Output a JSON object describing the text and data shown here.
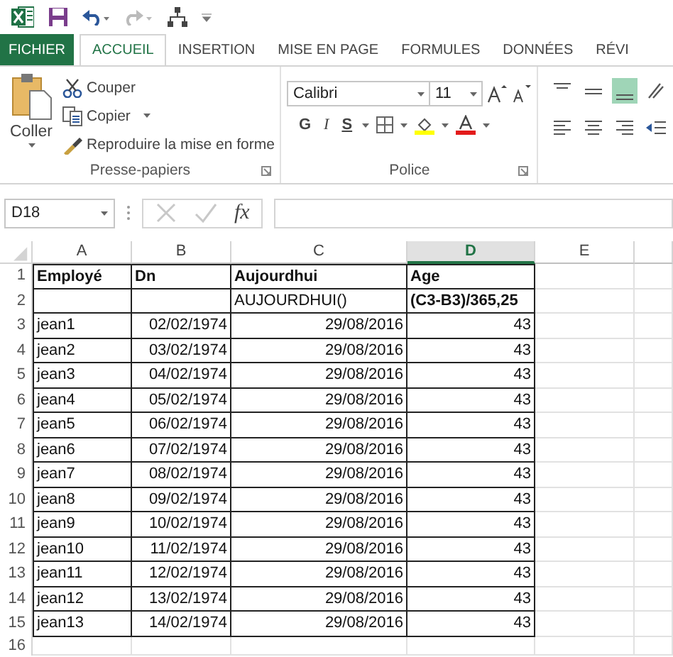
{
  "tabs": [
    {
      "label": "FICHIER",
      "kind": "file",
      "selected": false
    },
    {
      "label": "ACCUEIL",
      "kind": "tab",
      "selected": true
    },
    {
      "label": "INSERTION",
      "kind": "tab",
      "selected": false
    },
    {
      "label": "MISE EN PAGE",
      "kind": "tab",
      "selected": false
    },
    {
      "label": "FORMULES",
      "kind": "tab",
      "selected": false
    },
    {
      "label": "DONNÉES",
      "kind": "tab",
      "selected": false
    },
    {
      "label": "RÉVI",
      "kind": "tab",
      "selected": false
    }
  ],
  "clipboard": {
    "paste": "Coller",
    "cut": "Couper",
    "copy": "Copier",
    "format_painter": "Reproduire la mise en forme",
    "label": "Presse-papiers"
  },
  "font": {
    "font_name": "Calibri",
    "font_size": "11",
    "bold": "G",
    "italic": "I",
    "underline": "S",
    "label": "Police"
  },
  "formula_bar": {
    "name_box": "D18",
    "fx": "fx"
  },
  "columns": [
    {
      "label": "A",
      "selected": false
    },
    {
      "label": "B",
      "selected": false
    },
    {
      "label": "C",
      "selected": false
    },
    {
      "label": "D",
      "selected": true
    },
    {
      "label": "E",
      "selected": false
    }
  ],
  "rows": [
    {
      "number": "1",
      "cells": [
        {
          "text": "Employé",
          "kind": "text",
          "bold": true
        },
        {
          "text": "Dn",
          "kind": "text",
          "bold": true
        },
        {
          "text": "Aujourdhui",
          "kind": "text",
          "bold": true
        },
        {
          "text": "Age",
          "kind": "text",
          "bold": true
        }
      ]
    },
    {
      "number": "2",
      "cells": [
        null,
        null,
        {
          "text": "AUJOURDHUI()",
          "kind": "text",
          "bold": false
        },
        {
          "text": "(C3-B3)/365,25",
          "kind": "text",
          "bold": true
        }
      ]
    },
    {
      "number": "3",
      "cells": [
        {
          "text": "jean1",
          "kind": "text",
          "bold": false
        },
        {
          "text": "02/02/1974",
          "kind": "number",
          "bold": false
        },
        {
          "text": "29/08/2016",
          "kind": "number",
          "bold": false
        },
        {
          "text": "43",
          "kind": "number",
          "bold": false
        }
      ]
    },
    {
      "number": "4",
      "cells": [
        {
          "text": "jean2",
          "kind": "text",
          "bold": false
        },
        {
          "text": "03/02/1974",
          "kind": "number",
          "bold": false
        },
        {
          "text": "29/08/2016",
          "kind": "number",
          "bold": false
        },
        {
          "text": "43",
          "kind": "number",
          "bold": false
        }
      ]
    },
    {
      "number": "5",
      "cells": [
        {
          "text": "jean3",
          "kind": "text",
          "bold": false
        },
        {
          "text": "04/02/1974",
          "kind": "number",
          "bold": false
        },
        {
          "text": "29/08/2016",
          "kind": "number",
          "bold": false
        },
        {
          "text": "43",
          "kind": "number",
          "bold": false
        }
      ]
    },
    {
      "number": "6",
      "cells": [
        {
          "text": "jean4",
          "kind": "text",
          "bold": false
        },
        {
          "text": "05/02/1974",
          "kind": "number",
          "bold": false
        },
        {
          "text": "29/08/2016",
          "kind": "number",
          "bold": false
        },
        {
          "text": "43",
          "kind": "number",
          "bold": false
        }
      ]
    },
    {
      "number": "7",
      "cells": [
        {
          "text": "jean5",
          "kind": "text",
          "bold": false
        },
        {
          "text": "06/02/1974",
          "kind": "number",
          "bold": false
        },
        {
          "text": "29/08/2016",
          "kind": "number",
          "bold": false
        },
        {
          "text": "43",
          "kind": "number",
          "bold": false
        }
      ]
    },
    {
      "number": "8",
      "cells": [
        {
          "text": "jean6",
          "kind": "text",
          "bold": false
        },
        {
          "text": "07/02/1974",
          "kind": "number",
          "bold": false
        },
        {
          "text": "29/08/2016",
          "kind": "number",
          "bold": false
        },
        {
          "text": "43",
          "kind": "number",
          "bold": false
        }
      ]
    },
    {
      "number": "9",
      "cells": [
        {
          "text": "jean7",
          "kind": "text",
          "bold": false
        },
        {
          "text": "08/02/1974",
          "kind": "number",
          "bold": false
        },
        {
          "text": "29/08/2016",
          "kind": "number",
          "bold": false
        },
        {
          "text": "43",
          "kind": "number",
          "bold": false
        }
      ]
    },
    {
      "number": "10",
      "cells": [
        {
          "text": "jean8",
          "kind": "text",
          "bold": false
        },
        {
          "text": "09/02/1974",
          "kind": "number",
          "bold": false
        },
        {
          "text": "29/08/2016",
          "kind": "number",
          "bold": false
        },
        {
          "text": "43",
          "kind": "number",
          "bold": false
        }
      ]
    },
    {
      "number": "11",
      "cells": [
        {
          "text": "jean9",
          "kind": "text",
          "bold": false
        },
        {
          "text": "10/02/1974",
          "kind": "number",
          "bold": false
        },
        {
          "text": "29/08/2016",
          "kind": "number",
          "bold": false
        },
        {
          "text": "43",
          "kind": "number",
          "bold": false
        }
      ]
    },
    {
      "number": "12",
      "cells": [
        {
          "text": "jean10",
          "kind": "text",
          "bold": false
        },
        {
          "text": "11/02/1974",
          "kind": "number",
          "bold": false
        },
        {
          "text": "29/08/2016",
          "kind": "number",
          "bold": false
        },
        {
          "text": "43",
          "kind": "number",
          "bold": false
        }
      ]
    },
    {
      "number": "13",
      "cells": [
        {
          "text": "jean11",
          "kind": "text",
          "bold": false
        },
        {
          "text": "12/02/1974",
          "kind": "number",
          "bold": false
        },
        {
          "text": "29/08/2016",
          "kind": "number",
          "bold": false
        },
        {
          "text": "43",
          "kind": "number",
          "bold": false
        }
      ]
    },
    {
      "number": "14",
      "cells": [
        {
          "text": "jean12",
          "kind": "text",
          "bold": false
        },
        {
          "text": "13/02/1974",
          "kind": "number",
          "bold": false
        },
        {
          "text": "29/08/2016",
          "kind": "number",
          "bold": false
        },
        {
          "text": "43",
          "kind": "number",
          "bold": false
        }
      ]
    },
    {
      "number": "15",
      "cells": [
        {
          "text": "jean13",
          "kind": "text",
          "bold": false
        },
        {
          "text": "14/02/1974",
          "kind": "number",
          "bold": false
        },
        {
          "text": "29/08/2016",
          "kind": "number",
          "bold": false
        },
        {
          "text": "43",
          "kind": "number",
          "bold": false
        }
      ]
    },
    {
      "number": "16"
    }
  ]
}
